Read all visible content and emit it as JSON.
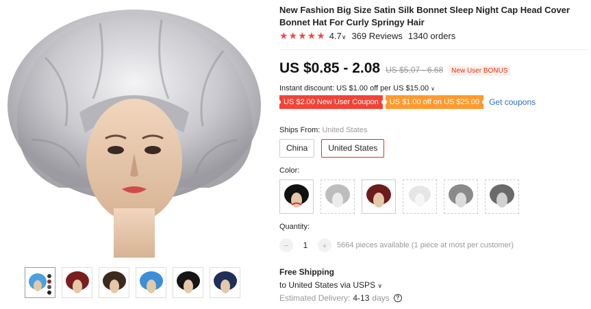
{
  "product": {
    "title": "New Fashion Big Size Satin Silk Bonnet Sleep Night Cap Head Cover Bonnet Hat For Curly Springy Hair",
    "stars": "★★★★★",
    "rating": "4.7",
    "reviews": "369 Reviews",
    "orders": "1340 orders"
  },
  "price": {
    "current": "US $0.85 - 2.08",
    "original": "US $5.07 - 6.68",
    "bonus_badge": "New User BONUS"
  },
  "discount": {
    "instant": "Instant discount: US $1.00 off per US $15.00",
    "coupons": [
      {
        "label": "US $2.00 New User Coupon",
        "color": "#f44336"
      },
      {
        "label": "US $1.00 off on US $25.00",
        "color": "#ff9a2e"
      }
    ],
    "get_coupons": "Get coupons"
  },
  "shipping_from": {
    "label": "Ships From:",
    "value": "United States",
    "options": [
      "China",
      "United States"
    ],
    "selected": "United States"
  },
  "color": {
    "label": "Color:",
    "swatches": [
      "black-red",
      "light-grey",
      "burgundy",
      "white",
      "grey",
      "dark-grey"
    ]
  },
  "quantity": {
    "label": "Quantity:",
    "minus": "−",
    "value": "1",
    "plus": "+",
    "available": "5664 pieces available (1 piece at most per customer)"
  },
  "delivery": {
    "free_shipping": "Free Shipping",
    "to": "to United States via USPS",
    "estimated_label": "Estimated Delivery:",
    "days": "4-13",
    "unit": "days"
  },
  "gallery": {
    "thumbnails": [
      "multi-color",
      "burgundy",
      "brown",
      "blue-pattern",
      "black",
      "navy"
    ]
  },
  "colors": {
    "accent_red": "#e62e04",
    "star_red": "#f04a4a",
    "link_blue": "#2a6fb5"
  }
}
